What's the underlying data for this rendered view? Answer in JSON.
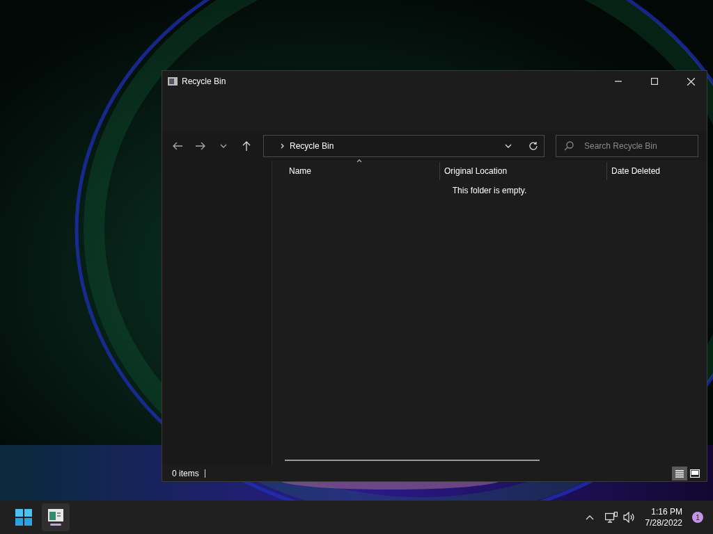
{
  "window": {
    "title": "Recycle Bin"
  },
  "address": {
    "path": "Recycle Bin"
  },
  "search": {
    "placeholder": "Search Recycle Bin"
  },
  "columns": [
    {
      "label": "Name",
      "sorted": true
    },
    {
      "label": "Original Location",
      "sorted": false
    },
    {
      "label": "Date Deleted",
      "sorted": false
    }
  ],
  "empty_message": "This folder is empty.",
  "status_bar": {
    "count": "0 items"
  },
  "view_buttons": [
    {
      "kind": "details",
      "selected": true
    },
    {
      "kind": "tiles",
      "selected": false
    }
  ],
  "taskbar": {
    "apps": [
      {
        "kind": "start",
        "running": false
      },
      {
        "kind": "explorer",
        "running": true
      }
    ],
    "clock": {
      "time": "1:16 PM",
      "date": "7/28/2022"
    },
    "notifications": "1"
  }
}
